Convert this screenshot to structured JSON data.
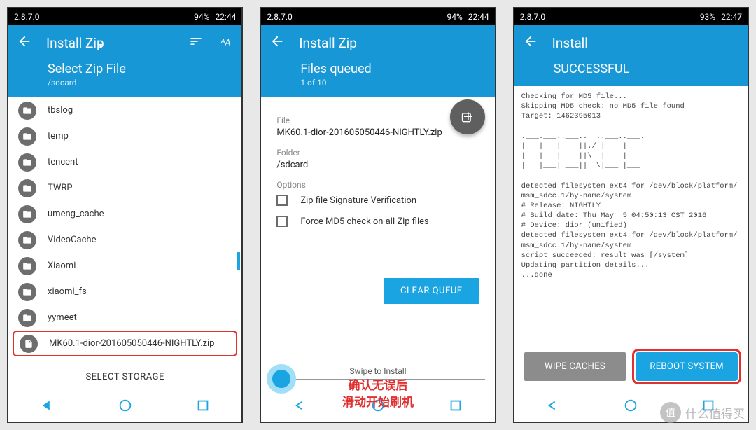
{
  "screens": [
    {
      "statusbar": {
        "version": "2.8.7.0",
        "battery": "94%",
        "time": "22:44"
      },
      "header": {
        "title": "Install Zip",
        "subtitle": "Select Zip File",
        "path": "/sdcard"
      },
      "files": [
        {
          "name": "tbslog",
          "type": "folder"
        },
        {
          "name": "temp",
          "type": "folder"
        },
        {
          "name": "tencent",
          "type": "folder"
        },
        {
          "name": "TWRP",
          "type": "folder"
        },
        {
          "name": "umeng_cache",
          "type": "folder"
        },
        {
          "name": "VideoCache",
          "type": "folder"
        },
        {
          "name": "Xiaomi",
          "type": "folder"
        },
        {
          "name": "xiaomi_fs",
          "type": "folder"
        },
        {
          "name": "yymeet",
          "type": "folder"
        },
        {
          "name": "MK60.1-dior-201605050446-NIGHTLY.zip",
          "type": "file",
          "highlighted": true
        }
      ],
      "select_storage": "SELECT STORAGE"
    },
    {
      "statusbar": {
        "version": "2.8.7.0",
        "battery": "94%",
        "time": "22:44"
      },
      "header": {
        "title": "Install Zip",
        "subtitle": "Files queued",
        "path": "1 of 10"
      },
      "file_label": "File",
      "file_value": "MK60.1-dior-201605050446-NIGHTLY.zip",
      "folder_label": "Folder",
      "folder_value": "/sdcard",
      "options_label": "Options",
      "options": [
        "Zip file Signature Verification",
        "Force MD5 check on all Zip files"
      ],
      "clear_queue": "CLEAR QUEUE",
      "swipe_label": "Swipe to Install",
      "cn_annotation": "确认无误后\n滑动开始刷机"
    },
    {
      "statusbar": {
        "version": "2.8.7.0",
        "battery": "93%",
        "time": "22:47"
      },
      "header": {
        "title": "Install",
        "subtitle": "SUCCESSFUL",
        "path": ""
      },
      "log": "Checking for MD5 file...\nSkipping MD5 check: no MD5 file found\nTarget: 1462395013\n\n.___.___..___..  ..___..___.\n|   |   ||   ||./ |___ |___ \n|   |   ||   ||\\  |    |    \n|   |___||___||  \\|___ |___ \n\ndetected filesystem ext4 for /dev/block/platform/msm_sdcc.1/by-name/system\n# Release: NIGHTLY\n# Build date: Thu May  5 04:50:13 CST 2016\n# Device: dior (unified)\ndetected filesystem ext4 for /dev/block/platform/msm_sdcc.1/by-name/system\nscript succeeded: result was [/system]\nUpdating partition details...\n...done",
      "wipe_caches": "WIPE CACHES",
      "reboot_system": "REBOOT SYSTEM"
    }
  ],
  "watermark": "什么值得买",
  "watermark_badge": "值"
}
